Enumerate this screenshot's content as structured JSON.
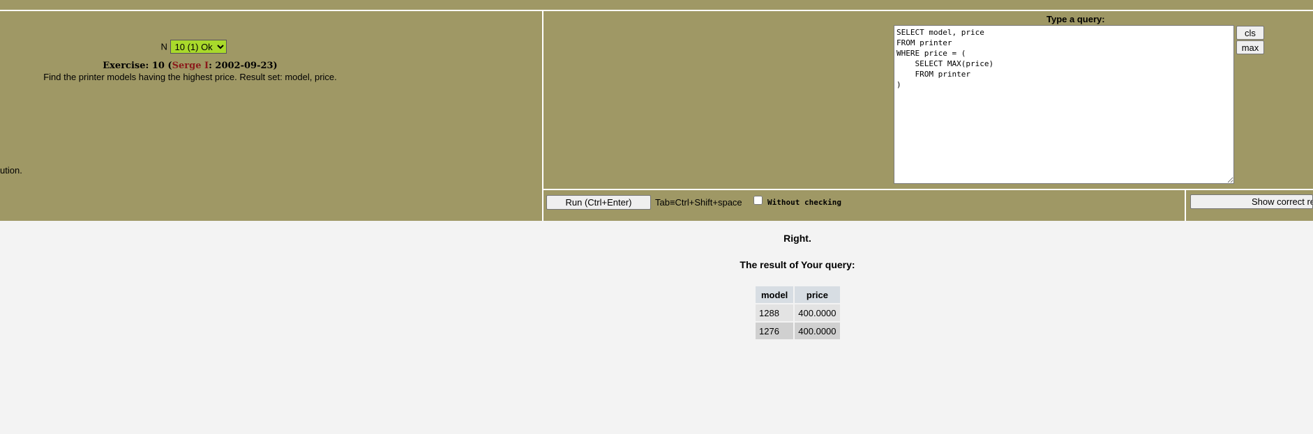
{
  "exercise": {
    "n_label": "N",
    "selected_option": "10 (1) Ok",
    "title_prefix": "Exercise: 10 (",
    "author": "Serge I",
    "title_suffix": ": 2002-09-23)",
    "description": "Find the printer models having the highest price. Result set: model, price.",
    "truncated_text": "ution."
  },
  "query": {
    "label": "Type a query:",
    "text": "SELECT model, price\nFROM printer\nWHERE price = (\n    SELECT MAX(price)\n    FROM printer\n)",
    "cls_label": "cls",
    "max_label": "max"
  },
  "controls": {
    "run_label": "Run (Ctrl+Enter)",
    "tab_hint": "Tab≡Ctrl+Shift+space",
    "without_checking_label": "Without checking",
    "without_checking_checked": false,
    "show_correct_label": "Show correct re"
  },
  "result": {
    "status": "Right.",
    "title": "The result of Your query:",
    "columns": [
      "model",
      "price"
    ],
    "rows": [
      [
        "1288",
        "400.0000"
      ],
      [
        "1276",
        "400.0000"
      ]
    ]
  },
  "colors": {
    "panel": "#9f9865",
    "page_bg": "#f3f3f3",
    "author": "#8b1a1a",
    "select_bg": "#a9d92b"
  }
}
